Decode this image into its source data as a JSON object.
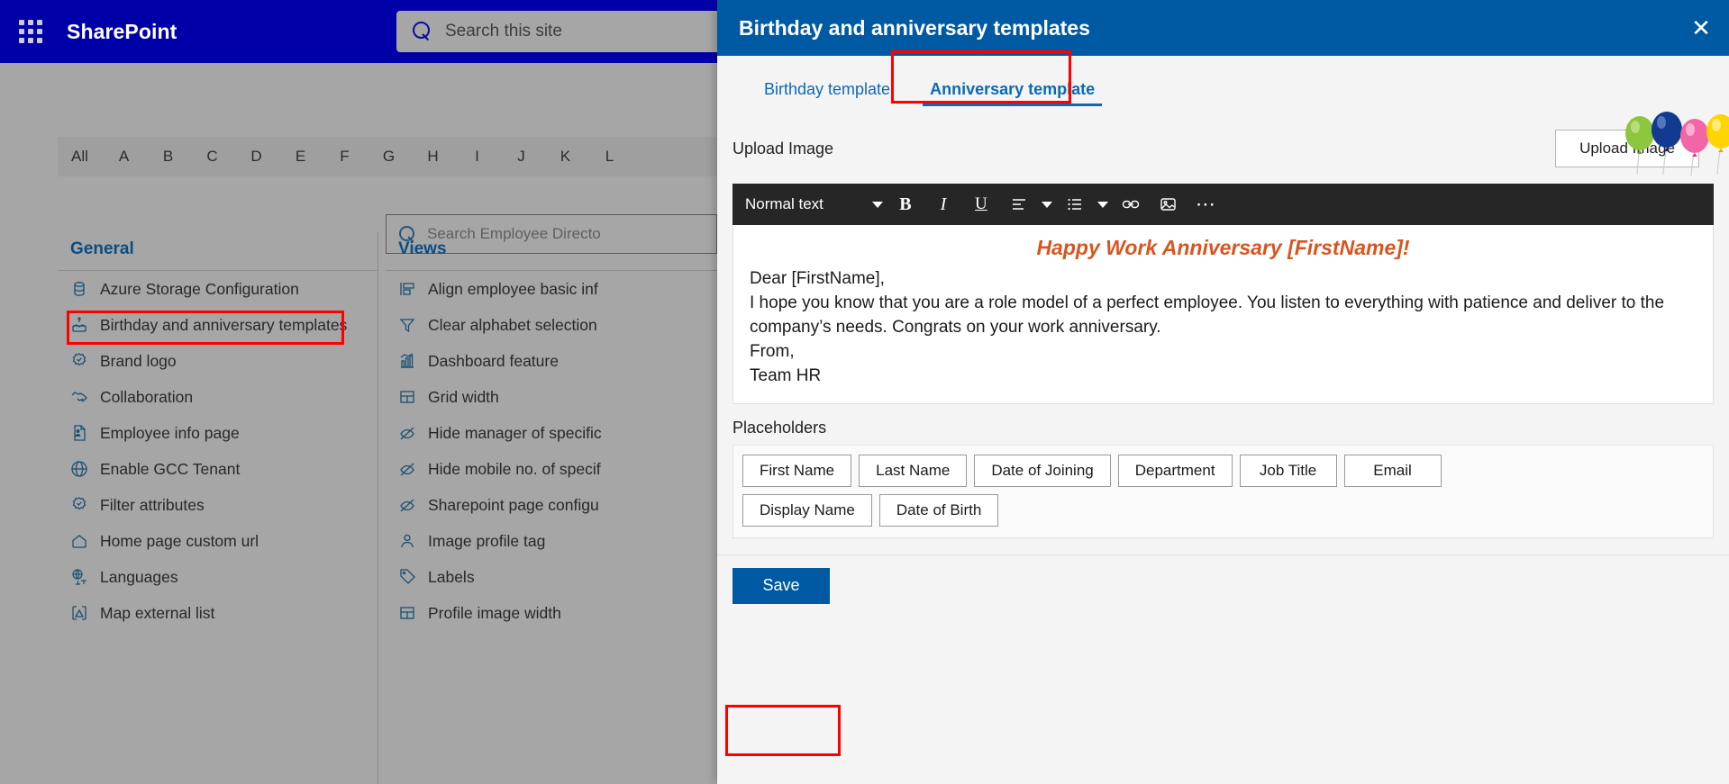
{
  "suite": {
    "waffle_icon": "app-launcher-icon",
    "brand": "SharePoint",
    "search_icon": "search-icon",
    "search_placeholder": "Search this site"
  },
  "background": {
    "alphabet": [
      "All",
      "A",
      "B",
      "C",
      "D",
      "E",
      "F",
      "G",
      "H",
      "I",
      "J",
      "K",
      "L"
    ],
    "directory_search": {
      "icon": "search-icon",
      "placeholder": "Search Employee Directo"
    },
    "general_column": {
      "header": "General",
      "items": [
        {
          "label": "Azure Storage Configuration",
          "icon": "database-icon"
        },
        {
          "label": "Birthday and anniversary templates",
          "icon": "cake-icon",
          "highlighted": true
        },
        {
          "label": "Brand logo",
          "icon": "badge-check-icon"
        },
        {
          "label": "Collaboration",
          "icon": "handshake-icon"
        },
        {
          "label": "Employee info page",
          "icon": "person-page-icon"
        },
        {
          "label": "Enable GCC Tenant",
          "icon": "globe-icon"
        },
        {
          "label": "Filter attributes",
          "icon": "badge-check-icon"
        },
        {
          "label": "Home page custom url",
          "icon": "home-icon"
        },
        {
          "label": "Languages",
          "icon": "translate-icon"
        },
        {
          "label": "Map external list",
          "icon": "map-list-icon"
        }
      ]
    },
    "views_column": {
      "header": "Views",
      "items": [
        {
          "label": "Align employee basic inf",
          "icon": "align-icon"
        },
        {
          "label": "Clear alphabet selection",
          "icon": "filter-icon"
        },
        {
          "label": "Dashboard feature",
          "icon": "chart-icon"
        },
        {
          "label": "Grid width",
          "icon": "grid-icon"
        },
        {
          "label": "Hide manager of specific",
          "icon": "hide-eye-icon"
        },
        {
          "label": "Hide mobile no. of specif",
          "icon": "hide-eye-icon"
        },
        {
          "label": "Sharepoint page configu",
          "icon": "hide-eye-icon"
        },
        {
          "label": "Image profile tag",
          "icon": "person-icon"
        },
        {
          "label": "Labels",
          "icon": "tag-icon"
        },
        {
          "label": "Profile image width",
          "icon": "grid-icon"
        }
      ]
    }
  },
  "panel": {
    "title": "Birthday and anniversary templates",
    "close_icon": "close-icon",
    "tabs": [
      {
        "label": "Birthday template",
        "active": false
      },
      {
        "label": "Anniversary template",
        "active": true,
        "highlighted": true
      }
    ],
    "decoration_icon": "balloons-image",
    "upload": {
      "label": "Upload Image",
      "button_label": "Upload Image"
    },
    "editor": {
      "style_label": "Normal text",
      "toolbar_icons": [
        "style-dropdown-caret-icon",
        "bold-icon",
        "italic-icon",
        "underline-icon",
        "align-left-icon",
        "align-dropdown-caret-icon",
        "bulleted-list-icon",
        "list-dropdown-caret-icon",
        "link-icon",
        "insert-image-icon",
        "more-options-icon"
      ],
      "heading": "Happy Work Anniversary [FirstName]!",
      "lines": [
        "Dear [FirstName],",
        "I hope you know that you are a role model of a perfect employee. You listen to everything with patience and deliver to the company’s needs. Congrats on your work anniversary.",
        "From,",
        "Team HR"
      ]
    },
    "placeholders": {
      "label": "Placeholders",
      "rows": [
        [
          "First Name",
          "Last Name",
          "Date of Joining",
          "Department",
          "Job Title",
          "Email"
        ],
        [
          "Display Name",
          "Date of Birth"
        ]
      ]
    },
    "footer": {
      "save_label": "Save",
      "save_highlighted": true
    }
  },
  "colors": {
    "suite_bar": "#0000a8",
    "panel_header": "#005aa3",
    "accent_link": "#0b6ab5",
    "heading_orange": "#d8551f",
    "highlight_red": "#ff0000",
    "save_blue": "#005aa3"
  }
}
